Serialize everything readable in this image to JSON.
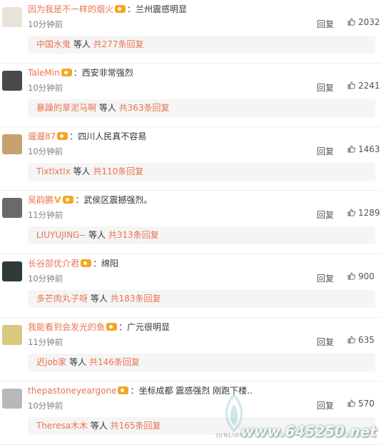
{
  "comments": [
    {
      "user": "因为我是不一样的烟火",
      "badge": "",
      "sep": "：",
      "text": "兰州震感明显",
      "time": "10分钟前",
      "reply_label": "回复",
      "likes": "2032",
      "sub": {
        "name": "中国水鬼",
        "mid": " 等人 ",
        "count": "共277条回复"
      }
    },
    {
      "user": "TaleMin",
      "badge": "",
      "sep": "：",
      "text": "西安非常强烈",
      "time": "10分钟前",
      "reply_label": "回复",
      "likes": "2241",
      "sub": {
        "name": "暴躁的草泥马啊",
        "mid": " 等人 ",
        "count": "共363条回复"
      }
    },
    {
      "user": "遛遛87",
      "badge": "",
      "sep": "：",
      "text": "四川人民真不容易",
      "time": "10分钟前",
      "reply_label": "回复",
      "likes": "1463",
      "sub": {
        "name": "Tixtlxtlx",
        "mid": " 等人 ",
        "count": "共110条回复"
      }
    },
    {
      "user": "吴韵鹏",
      "badge": "V",
      "sep": "：",
      "text": "武侯区震撼强烈。",
      "time": "11分钟前",
      "reply_label": "回复",
      "likes": "1289",
      "sub": {
        "name": "LIUYUJING--",
        "mid": " 等人 ",
        "count": "共313条回复"
      }
    },
    {
      "user": "长谷部优介君",
      "badge": "",
      "sep": "：",
      "text": "绵阳",
      "time": "10分钟前",
      "reply_label": "回复",
      "likes": "900",
      "sub": {
        "name": "多芒肉丸子呀",
        "mid": " 等人 ",
        "count": "共183条回复"
      }
    },
    {
      "user": "我能看到会发光的鱼",
      "badge": "",
      "sep": "：",
      "text": "广元很明显",
      "time": "11分钟前",
      "reply_label": "回复",
      "likes": "635",
      "sub": {
        "name": "迟job家",
        "mid": " 等人 ",
        "count": "共146条回复"
      }
    },
    {
      "user": "thepastoneyeargone",
      "badge": "",
      "sep": "：",
      "text": "坐标成都 震感强烈 刚跑下楼..",
      "time": "10分钟前",
      "reply_label": "回复",
      "likes": "570",
      "sub": {
        "name": "Theresa木木",
        "mid": " 等人 ",
        "count": "共165条回复"
      }
    }
  ],
  "colors": {
    "username": "#eb7350",
    "vip_badge": "#f5a623",
    "sub_bg": "#f5f5f5"
  },
  "watermark": {
    "site": "www.645250.net",
    "brand": "JUNLIAN"
  }
}
